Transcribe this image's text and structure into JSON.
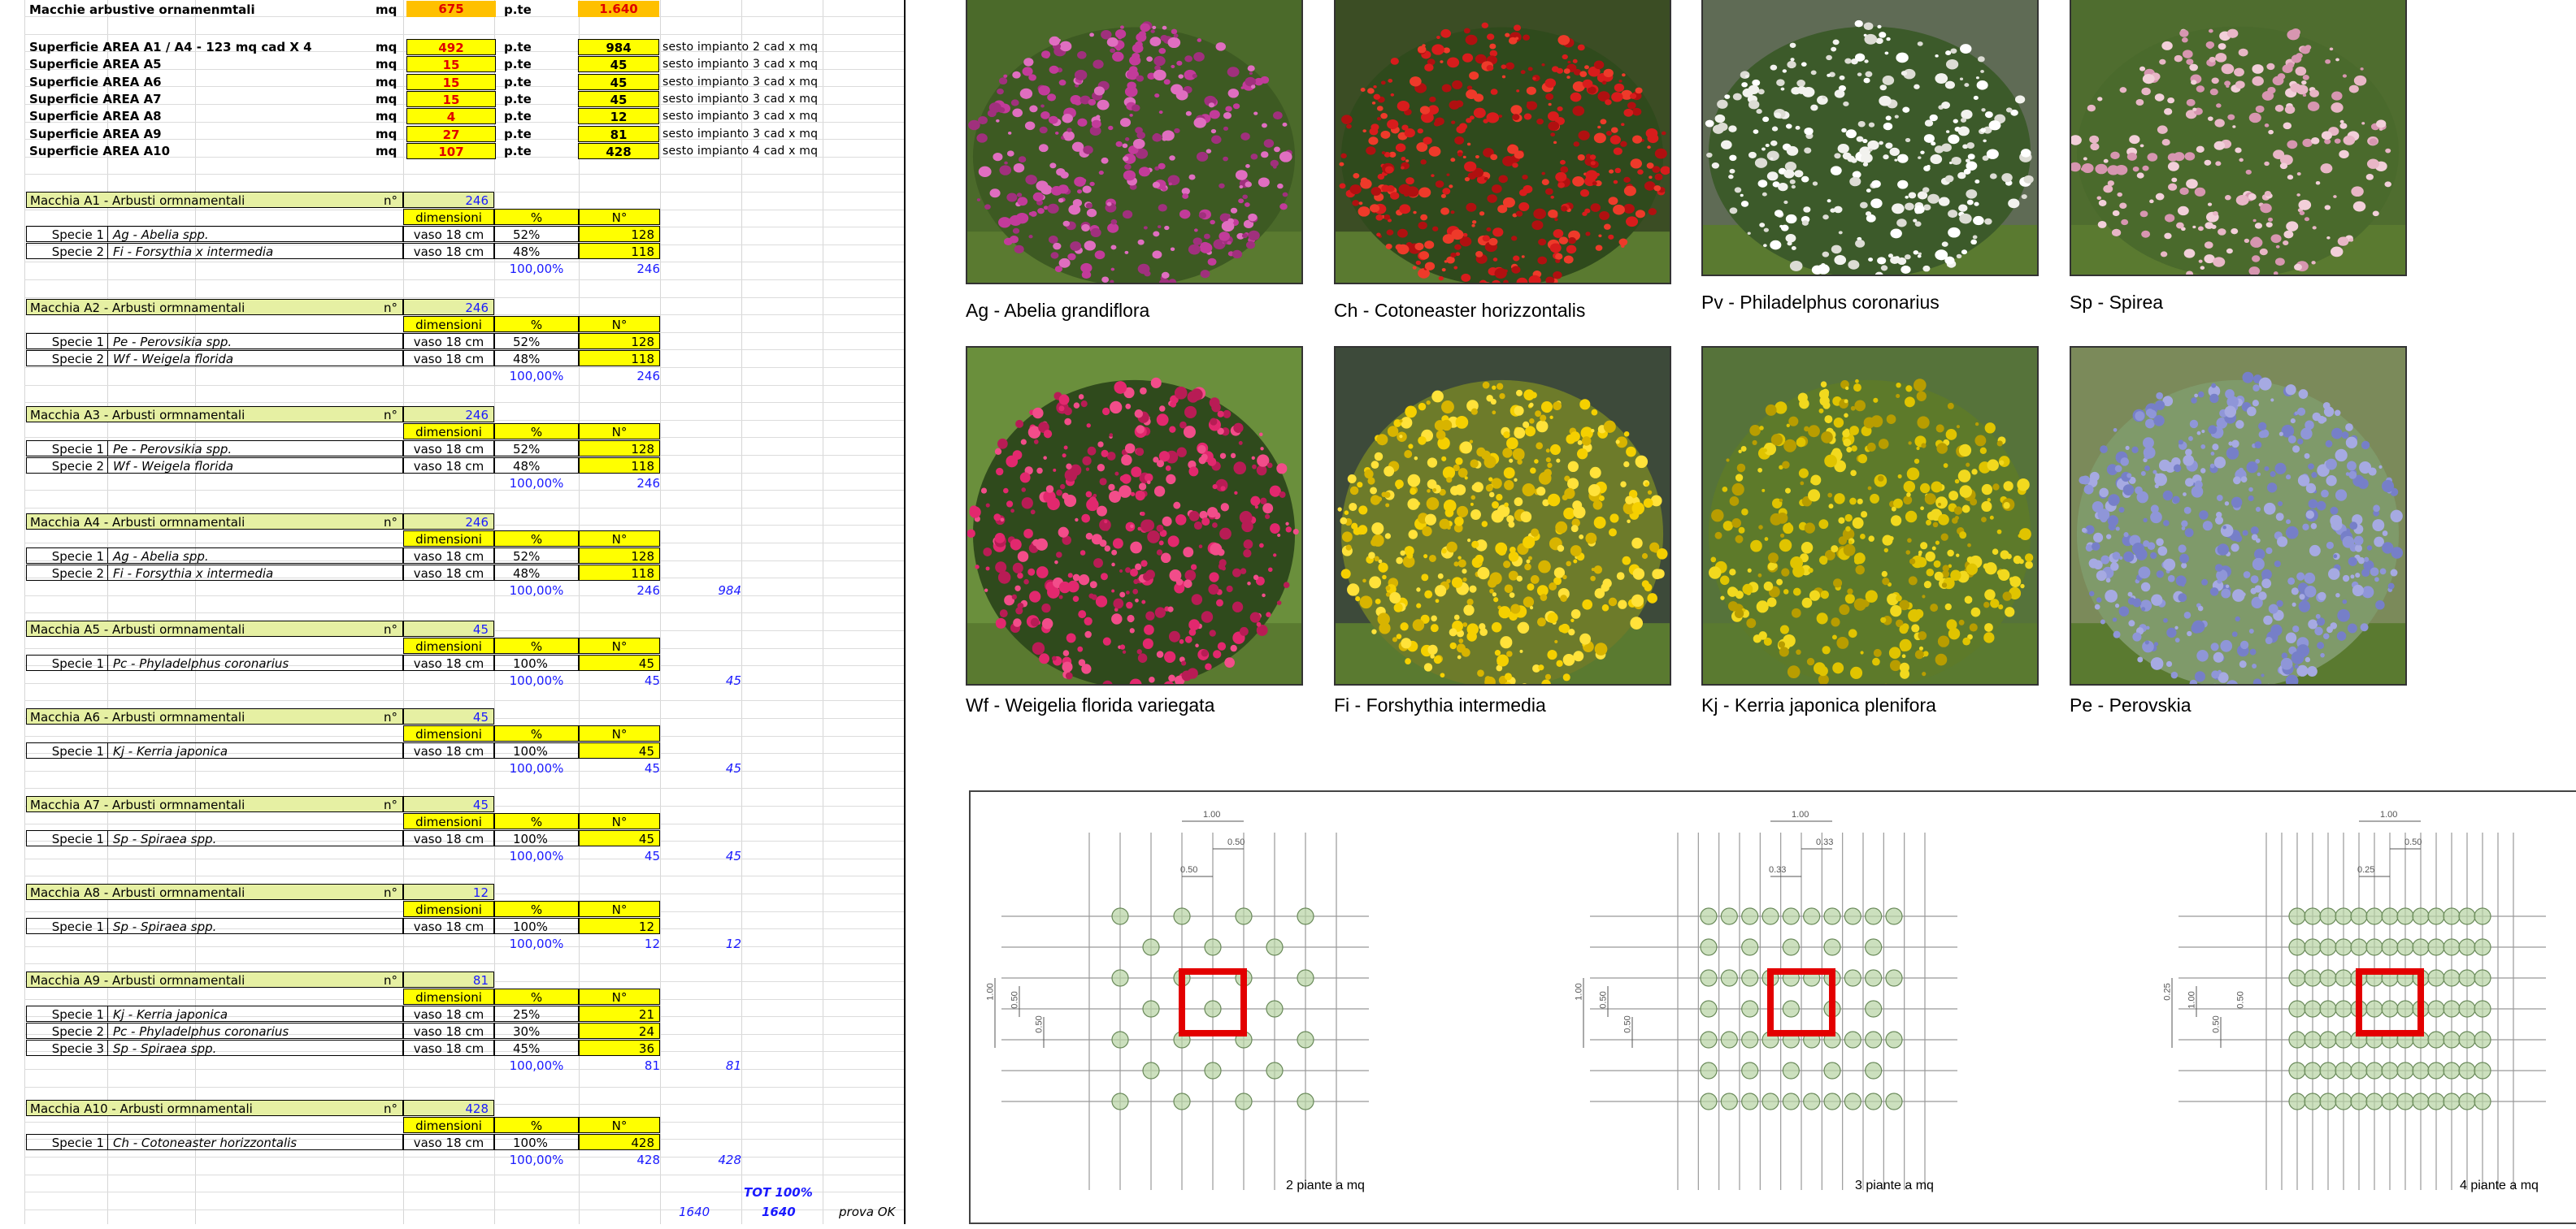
{
  "summary": {
    "top_row": {
      "label": "Macchie arbustive ornamenmtali",
      "unit": "mq",
      "value": "675",
      "unit2": "p.te",
      "total": "1.640"
    },
    "rows": [
      {
        "label": "Superficie AREA A1 / A4 - 123 mq cad X 4",
        "unit": "mq",
        "value": "492",
        "unit2": "p.te",
        "plants": "984",
        "note": "sesto impianto 2 cad x mq"
      },
      {
        "label": "Superficie AREA A5",
        "unit": "mq",
        "value": "15",
        "unit2": "p.te",
        "plants": "45",
        "note": "sesto impianto 3 cad x mq"
      },
      {
        "label": "Superficie AREA A6",
        "unit": "mq",
        "value": "15",
        "unit2": "p.te",
        "plants": "45",
        "note": "sesto impianto 3 cad x mq"
      },
      {
        "label": "Superficie AREA A7",
        "unit": "mq",
        "value": "15",
        "unit2": "p.te",
        "plants": "45",
        "note": "sesto impianto 3 cad x mq"
      },
      {
        "label": "Superficie AREA A8",
        "unit": "mq",
        "value": "4",
        "unit2": "p.te",
        "plants": "12",
        "note": "sesto impianto 3 cad x mq"
      },
      {
        "label": "Superficie AREA A9",
        "unit": "mq",
        "value": "27",
        "unit2": "p.te",
        "plants": "81",
        "note": "sesto impianto 3 cad x mq"
      },
      {
        "label": "Superficie AREA A10",
        "unit": "mq",
        "value": "107",
        "unit2": "p.te",
        "plants": "428",
        "note": "sesto impianto 4 cad x mq"
      }
    ]
  },
  "headers": {
    "dimensioni": "dimensioni",
    "pct": "%",
    "num": "N°",
    "n": "n°"
  },
  "groups": [
    {
      "title": "Macchia A1 - Arbusti ormnamentali",
      "count": "246",
      "species": [
        {
          "lbl": "Specie 1",
          "name": "Ag - Abelia spp.",
          "size": "vaso 18 cm",
          "pct": "52%",
          "num": "128"
        },
        {
          "lbl": "Specie 2",
          "name": "Fi - Forsythia x intermedia",
          "size": "vaso 18 cm",
          "pct": "48%",
          "num": "118"
        }
      ],
      "total_pct": "100,00%",
      "total_num": "246",
      "extra": ""
    },
    {
      "title": "Macchia A2 - Arbusti ormnamentali",
      "count": "246",
      "species": [
        {
          "lbl": "Specie 1",
          "name": "Pe - Perovsikia spp.",
          "size": "vaso 18 cm",
          "pct": "52%",
          "num": "128"
        },
        {
          "lbl": "Specie 2",
          "name": "Wf - Weigela florida",
          "size": "vaso 18 cm",
          "pct": "48%",
          "num": "118"
        }
      ],
      "total_pct": "100,00%",
      "total_num": "246",
      "extra": ""
    },
    {
      "title": "Macchia A3 - Arbusti ormnamentali",
      "count": "246",
      "species": [
        {
          "lbl": "Specie 1",
          "name": "Pe - Perovsikia spp.",
          "size": "vaso 18 cm",
          "pct": "52%",
          "num": "128"
        },
        {
          "lbl": "Specie 2",
          "name": "Wf - Weigela florida",
          "size": "vaso 18 cm",
          "pct": "48%",
          "num": "118"
        }
      ],
      "total_pct": "100,00%",
      "total_num": "246",
      "extra": ""
    },
    {
      "title": "Macchia A4 - Arbusti ormnamentali",
      "count": "246",
      "species": [
        {
          "lbl": "Specie 1",
          "name": "Ag - Abelia spp.",
          "size": "vaso 18 cm",
          "pct": "52%",
          "num": "128"
        },
        {
          "lbl": "Specie 2",
          "name": "Fi - Forsythia x intermedia",
          "size": "vaso 18 cm",
          "pct": "48%",
          "num": "118"
        }
      ],
      "total_pct": "100,00%",
      "total_num": "246",
      "extra": "984"
    },
    {
      "title": "Macchia A5 - Arbusti ormnamentali",
      "count": "45",
      "species": [
        {
          "lbl": "Specie 1",
          "name": "Pc - Phyladelphus coronarius",
          "size": "vaso 18 cm",
          "pct": "100%",
          "num": "45"
        }
      ],
      "total_pct": "100,00%",
      "total_num": "45",
      "extra": "45"
    },
    {
      "title": "Macchia A6 - Arbusti ormnamentali",
      "count": "45",
      "species": [
        {
          "lbl": "Specie 1",
          "name": "Kj - Kerria japonica",
          "size": "vaso 18 cm",
          "pct": "100%",
          "num": "45"
        }
      ],
      "total_pct": "100,00%",
      "total_num": "45",
      "extra": "45"
    },
    {
      "title": "Macchia A7 - Arbusti ormnamentali",
      "count": "45",
      "species": [
        {
          "lbl": "Specie 1",
          "name": "Sp - Spiraea spp.",
          "size": "vaso 18 cm",
          "pct": "100%",
          "num": "45"
        }
      ],
      "total_pct": "100,00%",
      "total_num": "45",
      "extra": "45"
    },
    {
      "title": "Macchia A8 - Arbusti ormnamentali",
      "count": "12",
      "species": [
        {
          "lbl": "Specie 1",
          "name": "Sp - Spiraea spp.",
          "size": "vaso 18 cm",
          "pct": "100%",
          "num": "12"
        }
      ],
      "total_pct": "100,00%",
      "total_num": "12",
      "extra": "12"
    },
    {
      "title": "Macchia A9 - Arbusti ormnamentali",
      "count": "81",
      "species": [
        {
          "lbl": "Specie 1",
          "name": "Kj - Kerria japonica",
          "size": "vaso 18 cm",
          "pct": "25%",
          "num": "21"
        },
        {
          "lbl": "Specie 2",
          "name": "Pc - Phyladelphus coronarius",
          "size": "vaso 18 cm",
          "pct": "30%",
          "num": "24"
        },
        {
          "lbl": "Specie 3",
          "name": "Sp - Spiraea spp.",
          "size": "vaso 18 cm",
          "pct": "45%",
          "num": "36"
        }
      ],
      "total_pct": "100,00%",
      "total_num": "81",
      "extra": "81"
    },
    {
      "title": "Macchia A10 - Arbusti ormnamentali",
      "count": "428",
      "species": [
        {
          "lbl": "Specie 1",
          "name": "Ch - Cotoneaster horizzontalis",
          "size": "vaso 18 cm",
          "pct": "100%",
          "num": "428"
        }
      ],
      "total_pct": "100,00%",
      "total_num": "428",
      "extra": "428"
    }
  ],
  "footer": {
    "tot_label": "TOT 100%",
    "left_total": "1640",
    "total": "1640",
    "check": "prova OK"
  },
  "photos": [
    {
      "caption": "Ag - Abelia grandiflora",
      "icon": "pink-shrub"
    },
    {
      "caption": "Ch - Cotoneaster horizzontalis",
      "icon": "red-berry-shrub"
    },
    {
      "caption": "Pv - Philadelphus coronarius",
      "icon": "white-flower-shrub"
    },
    {
      "caption": "Sp - Spirea",
      "icon": "pale-pink-shrub"
    },
    {
      "caption": "Wf - Weigelia florida variegata",
      "icon": "magenta-shrub"
    },
    {
      "caption": "Fi - Forshythia intermedia",
      "icon": "yellow-shrub"
    },
    {
      "caption": "Kj - Kerria japonica plenifora",
      "icon": "gold-shrub"
    },
    {
      "caption": "Pe - Perovskia",
      "icon": "lavender-shrub"
    }
  ],
  "diagrams": [
    {
      "label": "2 piante a mq",
      "dims": [
        "1.00",
        "0.50",
        "0.50",
        "1.00",
        "0.50",
        "0.50"
      ]
    },
    {
      "label": "3  piante a mq",
      "dims": [
        "1.00",
        "0.33",
        "0.33",
        "1.00",
        "0.50",
        "0.50"
      ]
    },
    {
      "label": "4 piante a mq",
      "dims": [
        "1.00",
        "0.50",
        "0.25",
        "0.25",
        "1.00",
        "0.50",
        "0.50"
      ]
    }
  ],
  "colors": {
    "accent_yellow": "#ffff00",
    "header_green": "#e6f0a3",
    "summary_orange": "#ffc000",
    "value_red": "#e00000",
    "total_blue": "#1a1aff",
    "plant_circle": "#b7d3a3",
    "square_red": "#e30000"
  }
}
